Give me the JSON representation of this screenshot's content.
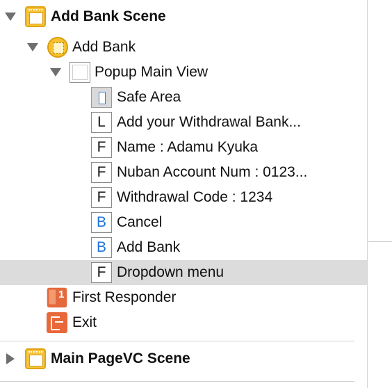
{
  "outline": {
    "scene1": {
      "title": "Add Bank Scene",
      "expanded": true,
      "icon": "storyboard-scene-icon",
      "view_controller": {
        "title": "Add Bank",
        "icon": "view-controller-icon",
        "popup": {
          "title": "Popup Main View",
          "icon": "view-icon",
          "children": [
            {
              "badge": "",
              "type": "safe-area",
              "label": "Safe Area"
            },
            {
              "badge": "L",
              "type": "label",
              "label": "Add your Withdrawal Bank..."
            },
            {
              "badge": "F",
              "type": "textfield",
              "label": "Name : Adamu Kyuka"
            },
            {
              "badge": "F",
              "type": "textfield",
              "label": "Nuban Account Num : 0123..."
            },
            {
              "badge": "F",
              "type": "textfield",
              "label": "Withdrawal Code : 1234"
            },
            {
              "badge": "B",
              "type": "button",
              "label": "Cancel"
            },
            {
              "badge": "B",
              "type": "button",
              "label": "Add Bank"
            },
            {
              "badge": "F",
              "type": "textfield",
              "label": "Dropdown menu",
              "selected": true
            }
          ]
        }
      },
      "first_responder": "First Responder",
      "exit": "Exit"
    },
    "scene2": {
      "title": "Main PageVC Scene",
      "expanded": false,
      "icon": "storyboard-scene-icon"
    }
  },
  "colors": {
    "selection": "#dcdcdc",
    "button_badge": "#1e73d8",
    "scene_icon": "#f7c43b",
    "responder_icon": "#e46a3d"
  }
}
